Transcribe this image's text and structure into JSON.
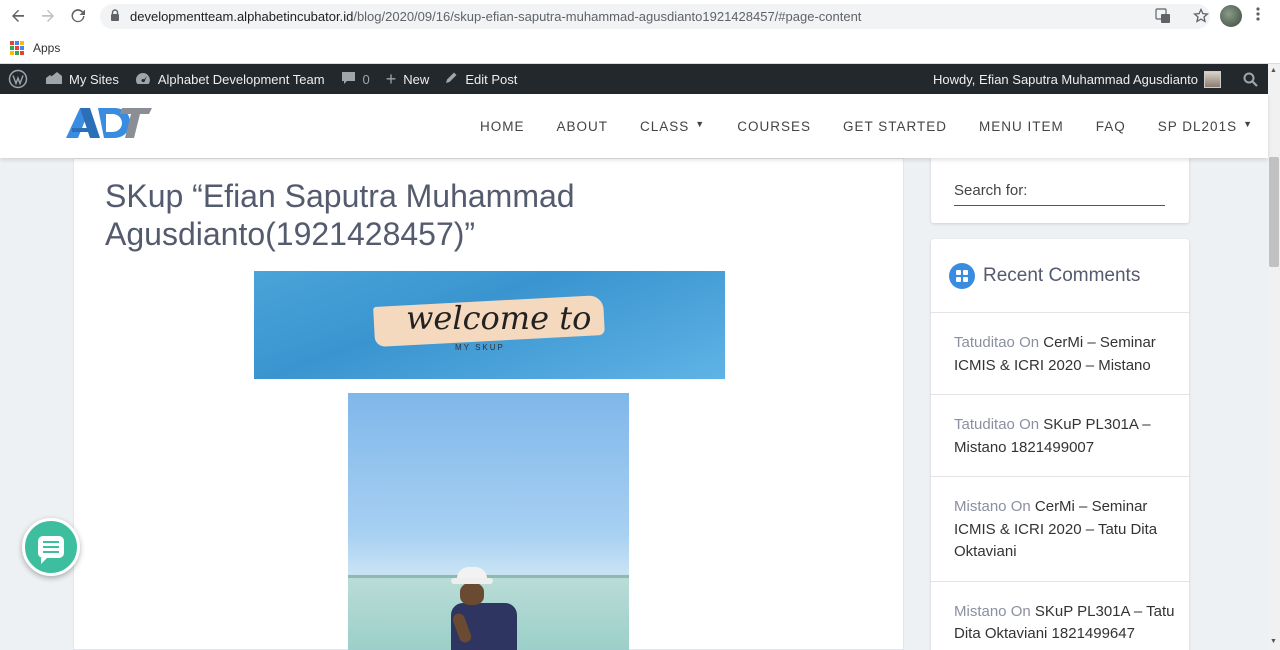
{
  "browser": {
    "url_host": "developmentteam.alphabetincubator.id",
    "url_path": "/blog/2020/09/16/skup-efian-saputra-muhammad-agusdianto1921428457/#page-content",
    "bookmarks_apps_label": "Apps"
  },
  "adminbar": {
    "wp_logo_icon": "wordpress-icon",
    "my_sites": "My Sites",
    "site_name": "Alphabet Development Team",
    "comments_count": "0",
    "new_label": "New",
    "edit_post": "Edit Post",
    "howdy": "Howdy, Efian Saputra Muhammad Agusdianto"
  },
  "header": {
    "logo_text": "ADT",
    "nav": [
      {
        "label": "HOME"
      },
      {
        "label": "ABOUT"
      },
      {
        "label": "CLASS",
        "has_dropdown": true
      },
      {
        "label": "COURSES"
      },
      {
        "label": "GET STARTED"
      },
      {
        "label": "MENU ITEM"
      },
      {
        "label": "FAQ"
      },
      {
        "label": "SP DL201S",
        "has_dropdown": true
      }
    ]
  },
  "post": {
    "title": "SKup “Efian Saputra Muhammad Agusdianto(1921428457)”",
    "banner_text": "welcome to",
    "banner_sub": "MY SKUP"
  },
  "sidebar": {
    "search_label": "Search for:",
    "recent_comments_title": "Recent Comments",
    "comments": [
      {
        "author": "Tatuditao",
        "on": "On",
        "post": "CerMi – Seminar ICMIS & ICRI 2020 – Mistano"
      },
      {
        "author": "Tatuditao",
        "on": "On",
        "post": "SKuP PL301A – Mistano 1821499007"
      },
      {
        "author": "Mistano",
        "on": "On",
        "post": "CerMi – Seminar ICMIS & ICRI 2020 – Tatu Dita Oktaviani"
      },
      {
        "author": "Mistano",
        "on": "On",
        "post": "SKuP PL301A – Tatu Dita Oktaviani 1821499647"
      }
    ]
  },
  "colors": {
    "adminbar_bg": "#23282d",
    "accent_blue": "#3a8ce0",
    "chat_fab": "#3dbf9f",
    "title_color": "#555b6e"
  }
}
